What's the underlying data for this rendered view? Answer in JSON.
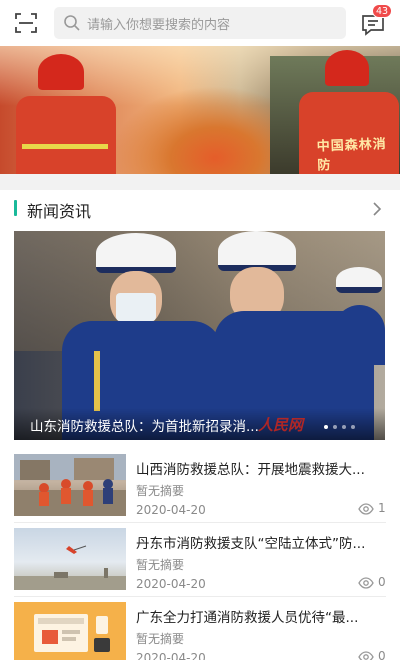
{
  "header": {
    "search_placeholder": "请输入你想要搜索的内容",
    "message_badge": "43"
  },
  "banner": {
    "slogan": "中国森林消防",
    "slide_count": 1
  },
  "news_section": {
    "title": "新闻资讯",
    "featured": {
      "title": "山东消防救援总队：为首批新招录消...",
      "watermark": "人民网",
      "dots": 4,
      "active_dot": 0
    },
    "items": [
      {
        "title": "山西消防救援总队：开展地震救援大...",
        "summary": "暂无摘要",
        "date": "2020-04-20",
        "views": "1"
      },
      {
        "title": "丹东市消防救援支队“空陆立体式”防...",
        "summary": "暂无摘要",
        "date": "2020-04-20",
        "views": "0"
      },
      {
        "title": "广东全力打通消防救援人员优待“最...",
        "summary": "暂无摘要",
        "date": "2020-04-20",
        "views": "0"
      }
    ]
  },
  "colors": {
    "accent": "#19b99a",
    "badge": "#f04a4a",
    "muted": "#8a8a8a"
  }
}
